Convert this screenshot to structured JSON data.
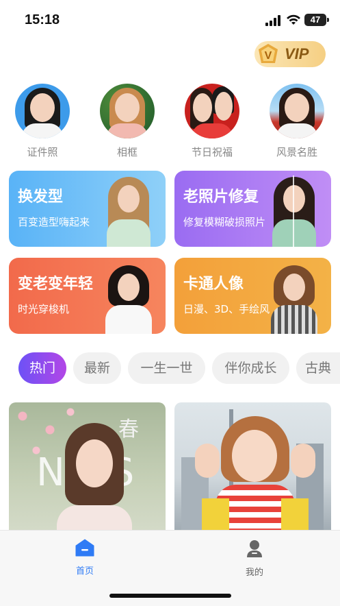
{
  "status_bar": {
    "time": "15:18",
    "battery": "47"
  },
  "vip": {
    "label": "VIP",
    "gem_letter": "V"
  },
  "categories": [
    {
      "label": "证件照"
    },
    {
      "label": "相框"
    },
    {
      "label": "节日祝福"
    },
    {
      "label": "风景名胜"
    }
  ],
  "feature_cards": [
    {
      "title": "换发型",
      "subtitle": "百变造型嗨起来"
    },
    {
      "title": "老照片修复",
      "subtitle": "修复模糊破损照片"
    },
    {
      "title": "变老变年轻",
      "subtitle": "时光穿梭机"
    },
    {
      "title": "卡通人像",
      "subtitle": "日漫、3D、手绘风"
    }
  ],
  "tabs": [
    "热门",
    "最新",
    "一生一世",
    "伴你成长",
    "古典"
  ],
  "photos": [
    {
      "overlay_text": "春",
      "letters": "N S"
    },
    {
      "overlay_text": ""
    }
  ],
  "tab_bar": {
    "home_label": "首页",
    "mine_label": "我的"
  },
  "colors": {
    "accent": "#2f7bf5",
    "tab_active_start": "#6d52f6",
    "tab_active_end": "#b246e6",
    "vip_gold": "#f5cf83"
  }
}
